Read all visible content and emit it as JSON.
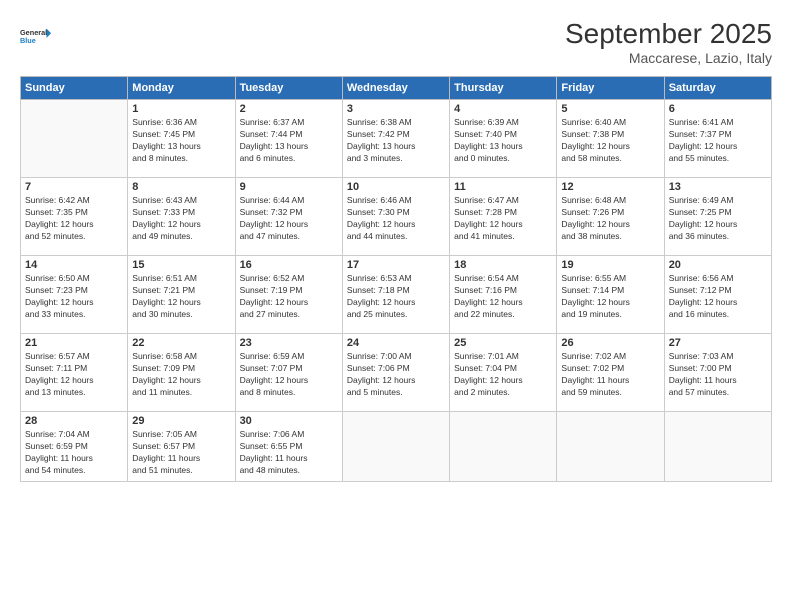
{
  "logo": {
    "line1": "General",
    "line2": "Blue"
  },
  "title": "September 2025",
  "location": "Maccarese, Lazio, Italy",
  "days_header": [
    "Sunday",
    "Monday",
    "Tuesday",
    "Wednesday",
    "Thursday",
    "Friday",
    "Saturday"
  ],
  "weeks": [
    [
      {
        "num": "",
        "info": ""
      },
      {
        "num": "1",
        "info": "Sunrise: 6:36 AM\nSunset: 7:45 PM\nDaylight: 13 hours\nand 8 minutes."
      },
      {
        "num": "2",
        "info": "Sunrise: 6:37 AM\nSunset: 7:44 PM\nDaylight: 13 hours\nand 6 minutes."
      },
      {
        "num": "3",
        "info": "Sunrise: 6:38 AM\nSunset: 7:42 PM\nDaylight: 13 hours\nand 3 minutes."
      },
      {
        "num": "4",
        "info": "Sunrise: 6:39 AM\nSunset: 7:40 PM\nDaylight: 13 hours\nand 0 minutes."
      },
      {
        "num": "5",
        "info": "Sunrise: 6:40 AM\nSunset: 7:38 PM\nDaylight: 12 hours\nand 58 minutes."
      },
      {
        "num": "6",
        "info": "Sunrise: 6:41 AM\nSunset: 7:37 PM\nDaylight: 12 hours\nand 55 minutes."
      }
    ],
    [
      {
        "num": "7",
        "info": "Sunrise: 6:42 AM\nSunset: 7:35 PM\nDaylight: 12 hours\nand 52 minutes."
      },
      {
        "num": "8",
        "info": "Sunrise: 6:43 AM\nSunset: 7:33 PM\nDaylight: 12 hours\nand 49 minutes."
      },
      {
        "num": "9",
        "info": "Sunrise: 6:44 AM\nSunset: 7:32 PM\nDaylight: 12 hours\nand 47 minutes."
      },
      {
        "num": "10",
        "info": "Sunrise: 6:46 AM\nSunset: 7:30 PM\nDaylight: 12 hours\nand 44 minutes."
      },
      {
        "num": "11",
        "info": "Sunrise: 6:47 AM\nSunset: 7:28 PM\nDaylight: 12 hours\nand 41 minutes."
      },
      {
        "num": "12",
        "info": "Sunrise: 6:48 AM\nSunset: 7:26 PM\nDaylight: 12 hours\nand 38 minutes."
      },
      {
        "num": "13",
        "info": "Sunrise: 6:49 AM\nSunset: 7:25 PM\nDaylight: 12 hours\nand 36 minutes."
      }
    ],
    [
      {
        "num": "14",
        "info": "Sunrise: 6:50 AM\nSunset: 7:23 PM\nDaylight: 12 hours\nand 33 minutes."
      },
      {
        "num": "15",
        "info": "Sunrise: 6:51 AM\nSunset: 7:21 PM\nDaylight: 12 hours\nand 30 minutes."
      },
      {
        "num": "16",
        "info": "Sunrise: 6:52 AM\nSunset: 7:19 PM\nDaylight: 12 hours\nand 27 minutes."
      },
      {
        "num": "17",
        "info": "Sunrise: 6:53 AM\nSunset: 7:18 PM\nDaylight: 12 hours\nand 25 minutes."
      },
      {
        "num": "18",
        "info": "Sunrise: 6:54 AM\nSunset: 7:16 PM\nDaylight: 12 hours\nand 22 minutes."
      },
      {
        "num": "19",
        "info": "Sunrise: 6:55 AM\nSunset: 7:14 PM\nDaylight: 12 hours\nand 19 minutes."
      },
      {
        "num": "20",
        "info": "Sunrise: 6:56 AM\nSunset: 7:12 PM\nDaylight: 12 hours\nand 16 minutes."
      }
    ],
    [
      {
        "num": "21",
        "info": "Sunrise: 6:57 AM\nSunset: 7:11 PM\nDaylight: 12 hours\nand 13 minutes."
      },
      {
        "num": "22",
        "info": "Sunrise: 6:58 AM\nSunset: 7:09 PM\nDaylight: 12 hours\nand 11 minutes."
      },
      {
        "num": "23",
        "info": "Sunrise: 6:59 AM\nSunset: 7:07 PM\nDaylight: 12 hours\nand 8 minutes."
      },
      {
        "num": "24",
        "info": "Sunrise: 7:00 AM\nSunset: 7:06 PM\nDaylight: 12 hours\nand 5 minutes."
      },
      {
        "num": "25",
        "info": "Sunrise: 7:01 AM\nSunset: 7:04 PM\nDaylight: 12 hours\nand 2 minutes."
      },
      {
        "num": "26",
        "info": "Sunrise: 7:02 AM\nSunset: 7:02 PM\nDaylight: 11 hours\nand 59 minutes."
      },
      {
        "num": "27",
        "info": "Sunrise: 7:03 AM\nSunset: 7:00 PM\nDaylight: 11 hours\nand 57 minutes."
      }
    ],
    [
      {
        "num": "28",
        "info": "Sunrise: 7:04 AM\nSunset: 6:59 PM\nDaylight: 11 hours\nand 54 minutes."
      },
      {
        "num": "29",
        "info": "Sunrise: 7:05 AM\nSunset: 6:57 PM\nDaylight: 11 hours\nand 51 minutes."
      },
      {
        "num": "30",
        "info": "Sunrise: 7:06 AM\nSunset: 6:55 PM\nDaylight: 11 hours\nand 48 minutes."
      },
      {
        "num": "",
        "info": ""
      },
      {
        "num": "",
        "info": ""
      },
      {
        "num": "",
        "info": ""
      },
      {
        "num": "",
        "info": ""
      }
    ]
  ]
}
